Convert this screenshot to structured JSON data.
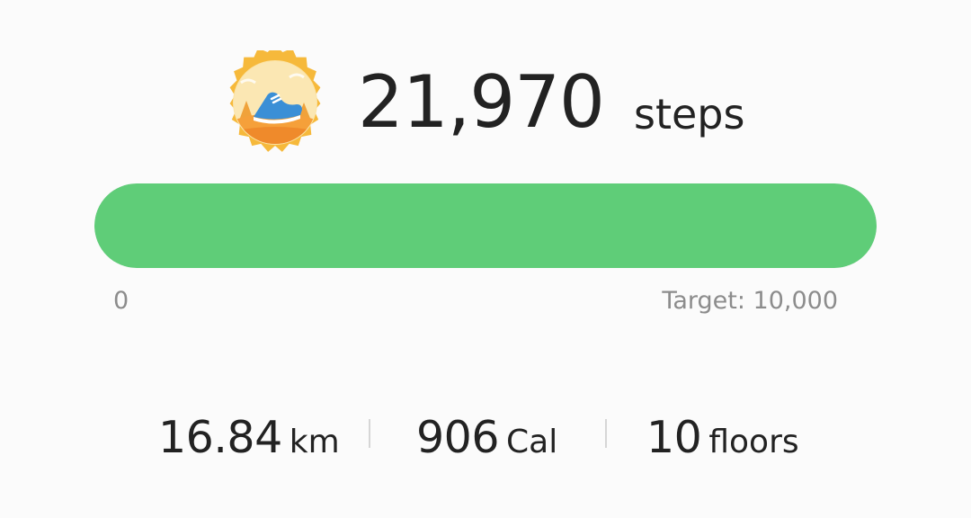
{
  "summary": {
    "steps_value": "21,970",
    "steps_unit": "steps",
    "badge_icon": "running-shoe-badge-icon"
  },
  "progress": {
    "min_label": "0",
    "target_label": "Target: 10,000",
    "fill_fraction": 1.0,
    "fill_color": "#5fcd78"
  },
  "stats": {
    "distance_value": "16.84",
    "distance_unit": "km",
    "calories_value": "906",
    "calories_unit": "Cal",
    "floors_value": "10",
    "floors_unit": "floors"
  }
}
